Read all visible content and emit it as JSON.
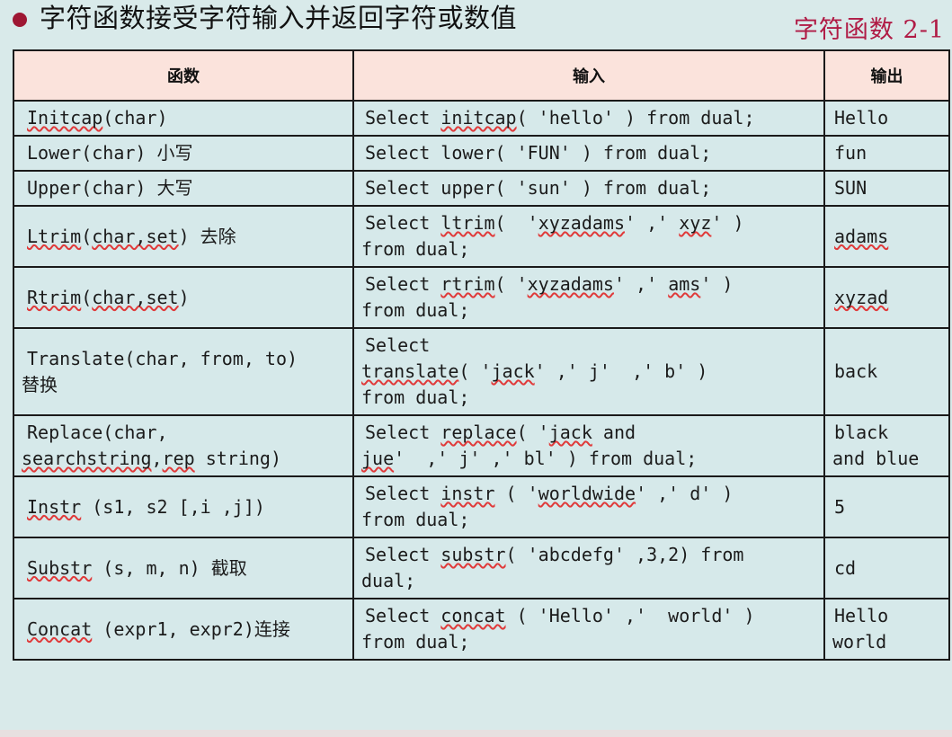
{
  "slide": {
    "bullet_icon": "bullet-dot-icon",
    "heading": "字符函数接受字符输入并返回字符或数值",
    "title": "字符函数 2-1",
    "accent_color": "#b01b45",
    "header_row_color": "#fbe3dc",
    "cell_color": "#d6e9ea",
    "page_background": "#d9eaea"
  },
  "table": {
    "columns": [
      "函数",
      "输入",
      "输出"
    ],
    "rows": [
      {
        "function": "Initcap(char)",
        "input": "Select initcap( 'hello' ) from dual;",
        "output": "Hello"
      },
      {
        "function": "Lower(char) 小写",
        "input": "Select lower( 'FUN' ) from dual;",
        "output": "fun"
      },
      {
        "function": "Upper(char) 大写",
        "input": "Select upper( 'sun' ) from dual;",
        "output": "SUN"
      },
      {
        "function": "Ltrim(char,set) 去除",
        "input": "Select ltrim(  'xyzadams' ,' xyz' )\nfrom dual;",
        "output": "adams"
      },
      {
        "function": "Rtrim(char,set)",
        "input": "Select rtrim( 'xyzadams' ,' ams' )\nfrom dual;",
        "output": "xyzad"
      },
      {
        "function": "Translate(char, from, to)\n替换",
        "input": "Select\ntranslate( 'jack' ,' j'  ,' b' )\nfrom dual;",
        "output": "back"
      },
      {
        "function": "Replace(char,\nsearchstring,rep string)",
        "input": "Select replace( 'jack and\njue'  ,' j' ,' bl' ) from dual;",
        "output": "black\nand blue"
      },
      {
        "function": "Instr (s1, s2 [,i ,j])",
        "input": "Select instr ( 'worldwide' ,' d' )\nfrom dual;",
        "output": "5"
      },
      {
        "function": "Substr (s, m, n) 截取",
        "input": "Select substr( 'abcdefg' ,3,2) from\ndual;",
        "output": "cd"
      },
      {
        "function": "Concat (expr1, expr2)连接",
        "input": "Select concat ( 'Hello' ,'  world' )\nfrom dual;",
        "output": "Hello\nworld"
      }
    ]
  }
}
